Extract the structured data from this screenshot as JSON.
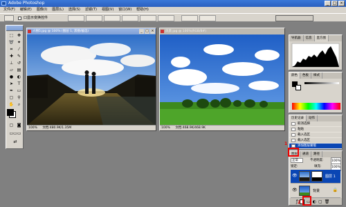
{
  "app": {
    "title": "Adobe Photoshop"
  },
  "menu": [
    "文件(F)",
    "编辑(E)",
    "图像(I)",
    "图层(L)",
    "选择(S)",
    "滤镜(T)",
    "视图(V)",
    "窗口(W)",
    "帮助(H)"
  ],
  "options": {
    "checkbox_label": "口显示变换控件",
    "buttons": [
      "",
      "",
      "",
      "",
      "",
      "",
      "",
      ""
    ]
  },
  "doc1": {
    "title": "人物5.jpg @ 100% (图层 1, 黑圈/截选)",
    "zoom": "100%",
    "info": "文档:480.9K/1.35M"
  },
  "doc2": {
    "title": "风景.jpg @ 100%(RGB/8#)",
    "zoom": "100%",
    "info": "文档:468.9K/468.9K"
  },
  "navigator": {
    "tabs": [
      "导航器",
      "信息",
      "直方图"
    ]
  },
  "color": {
    "tabs": [
      "颜色",
      "色板",
      "样式"
    ]
  },
  "history": {
    "tabs": [
      "历史记录",
      "动作"
    ],
    "items": [
      "取消选择",
      "粘贴",
      "载入选区",
      "载入选区",
      "添加图层蒙版"
    ]
  },
  "layers": {
    "tabs": [
      "图层",
      "通道",
      "路径"
    ],
    "blend_mode": "正常",
    "opacity_label": "不透明度:",
    "opacity_value": "100%",
    "lock_label": "锁定:",
    "fill_label": "填充:",
    "fill_value": "100%",
    "items": [
      {
        "name": "图层 1"
      },
      {
        "name": "背景"
      }
    ]
  },
  "annotations": {
    "step1": "1",
    "step2": "2"
  },
  "colors": {
    "accent": "#0a46b4",
    "highlight": "#ee0000",
    "titlebar": "#2a5fc0"
  }
}
